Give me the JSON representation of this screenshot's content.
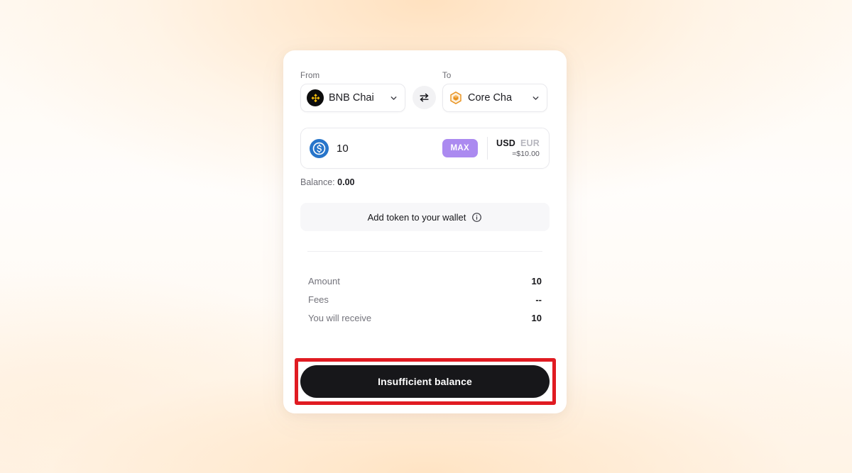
{
  "bridge": {
    "from": {
      "label": "From",
      "chain_name": "BNB Chai",
      "icon": "bnb-chain-icon",
      "icon_bg": "#0d0d0d",
      "icon_fg": "#f0b90b"
    },
    "to": {
      "label": "To",
      "chain_name": "Core Cha",
      "icon": "core-chain-icon",
      "icon_fg": "#e8921f"
    },
    "swap_icon": "swap-arrows-icon",
    "amount": {
      "token_icon": "usdc-token-icon",
      "token_icon_color": "#2775ca",
      "value": "10",
      "placeholder": "0",
      "max_label": "MAX",
      "max_color": "#ab8af0",
      "fiat_tabs": [
        {
          "label": "USD",
          "active": true
        },
        {
          "label": "EUR",
          "active": false
        }
      ],
      "approx": "≈$10.00"
    },
    "balance": {
      "label": "Balance:",
      "value": "0.00"
    },
    "add_token": {
      "label": "Add token to your wallet",
      "icon": "info-circle-icon"
    },
    "summary": [
      {
        "key": "Amount",
        "value": "10"
      },
      {
        "key": "Fees",
        "value": "--"
      },
      {
        "key": "You will receive",
        "value": "10"
      }
    ],
    "cta": {
      "label": "Insufficient balance",
      "bg": "#17171a",
      "disabled": true
    },
    "annotation": {
      "type": "highlight-rectangle",
      "color": "#e01b22"
    }
  }
}
